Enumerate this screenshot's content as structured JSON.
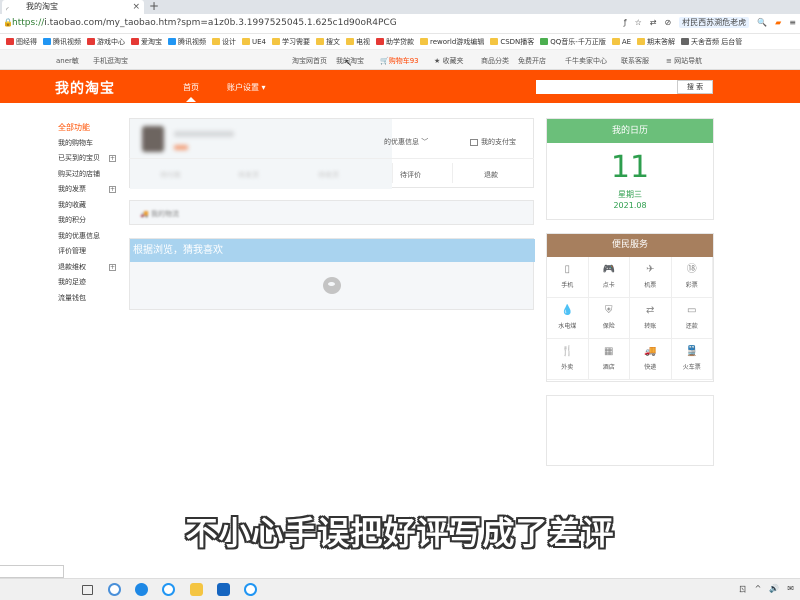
{
  "browser": {
    "tab_title": "我的淘宝",
    "tab_close": "×",
    "new_tab": "+",
    "url_scheme": "https://",
    "url_rest": "i.taobao.com/my_taobao.htm?spm=a1z0b.3.1997525045.1.625c1d90oR4PCG",
    "tools": [
      "ƒ",
      "☆",
      "⇄",
      "⊘"
    ],
    "search_chip": "村民西苏溯危老虎",
    "bookmarks": [
      {
        "label": "图经得",
        "color": "#e53935"
      },
      {
        "label": "腾讯视频",
        "color": "#2196f3"
      },
      {
        "label": "游戏中心",
        "color": "#e53935"
      },
      {
        "label": "爱淘宝",
        "color": "#e53935"
      },
      {
        "label": "腾讯视频",
        "color": "#2196f3"
      },
      {
        "label": "设计",
        "color": "#f4c542"
      },
      {
        "label": "UE4",
        "color": "#f4c542"
      },
      {
        "label": "学习需要",
        "color": "#f4c542"
      },
      {
        "label": "搜文",
        "color": "#f4c542"
      },
      {
        "label": "电视",
        "color": "#f4c542"
      },
      {
        "label": "助学贷款",
        "color": "#e53935"
      },
      {
        "label": "reworld游戏编辑",
        "color": "#f4c542"
      },
      {
        "label": "CSDN播客",
        "color": "#f4c542"
      },
      {
        "label": "QQ音乐-千万正版",
        "color": "#4caf50"
      },
      {
        "label": "AE",
        "color": "#f4c542"
      },
      {
        "label": "期末答解",
        "color": "#f4c542"
      },
      {
        "label": "天舍音频 后台管",
        "color": "#666666"
      }
    ]
  },
  "sitenav": {
    "user": "aner敏",
    "mobile": "手机逛淘宝",
    "home": "淘宝网首页",
    "my_taobao": "我的淘宝",
    "cart": "购物车93",
    "favorites": "收藏夹",
    "categories": "商品分类",
    "free_shop": "免费开店",
    "seller_center": "千牛卖家中心",
    "contact": "联系客服",
    "site_nav": "网站导航"
  },
  "header": {
    "logo": "我的淘宝",
    "home": "首页",
    "settings": "账户设置",
    "search_btn": "搜 索"
  },
  "leftmenu": [
    {
      "label": "全部功能",
      "active": true,
      "plus": false
    },
    {
      "label": "我的购物车",
      "active": false,
      "plus": false
    },
    {
      "label": "已买到的宝贝",
      "active": false,
      "plus": true
    },
    {
      "label": "购买过的店铺",
      "active": false,
      "plus": false
    },
    {
      "label": "我的发票",
      "active": false,
      "plus": true
    },
    {
      "label": "我的收藏",
      "active": false,
      "plus": false
    },
    {
      "label": "我的积分",
      "active": false,
      "plus": false
    },
    {
      "label": "我的优惠信息",
      "active": false,
      "plus": false
    },
    {
      "label": "评价管理",
      "active": false,
      "plus": false
    },
    {
      "label": "退款维权",
      "active": false,
      "plus": true
    },
    {
      "label": "我的足迹",
      "active": false,
      "plus": false
    },
    {
      "label": "流量钱包",
      "active": false,
      "plus": false
    }
  ],
  "main": {
    "coupon_info": "的优惠信息 ﹀",
    "alipay": "我的支付宝",
    "orders": [
      "待付款",
      "待发货",
      "待收货",
      "待评价",
      "退款"
    ],
    "logistics": "我的物流",
    "guess_title": "根据浏览，猜我喜欢"
  },
  "calendar": {
    "title": "我的日历",
    "day": "11",
    "weekday": "星期三",
    "month": "2021.08"
  },
  "services": {
    "title": "便民服务",
    "items": [
      {
        "label": "手机",
        "icon": "phone-icon",
        "glyph": "▯"
      },
      {
        "label": "点卡",
        "icon": "gamepad-icon",
        "glyph": "🎮"
      },
      {
        "label": "机票",
        "icon": "plane-icon",
        "glyph": "✈"
      },
      {
        "label": "彩票",
        "icon": "lottery-icon",
        "glyph": "⑱"
      },
      {
        "label": "水电煤",
        "icon": "water-icon",
        "glyph": "💧"
      },
      {
        "label": "保险",
        "icon": "shield-icon",
        "glyph": "⛨"
      },
      {
        "label": "转账",
        "icon": "transfer-icon",
        "glyph": "⇄"
      },
      {
        "label": "还款",
        "icon": "card-icon",
        "glyph": "▭"
      },
      {
        "label": "外卖",
        "icon": "utensils-icon",
        "glyph": "🍴"
      },
      {
        "label": "酒店",
        "icon": "hotel-icon",
        "glyph": "▦"
      },
      {
        "label": "快递",
        "icon": "truck-icon",
        "glyph": "🚚"
      },
      {
        "label": "火车票",
        "icon": "train-icon",
        "glyph": "🚆"
      }
    ]
  },
  "subtitle": "不小心手误把好评写成了差评",
  "taskbar": {
    "tray": [
      "ㄖ",
      "^",
      "🔊",
      "✉"
    ]
  },
  "colors": {
    "brand": "#ff5000",
    "calendar": "#6bbf7a",
    "services": "#a77f5e",
    "guess": "#a9d3ef"
  }
}
